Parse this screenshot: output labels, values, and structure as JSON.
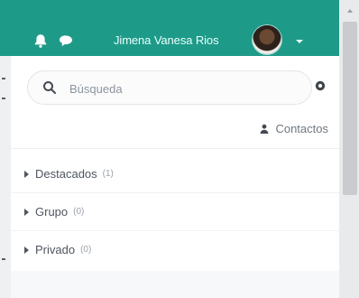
{
  "header": {
    "user_name": "Jimena Vanesa Rios",
    "bell_icon": "bell-icon",
    "chat_icon": "chat-bubble-icon",
    "avatar_icon": "user-avatar",
    "dropdown_icon": "caret-down-icon",
    "bg_color": "#1e9a89"
  },
  "search": {
    "placeholder": "Búsqueda",
    "value": "",
    "icon": "search-icon"
  },
  "settings": {
    "icon": "gear-icon"
  },
  "contacts": {
    "label": "Contactos",
    "icon": "user-icon"
  },
  "groups": [
    {
      "label": "Destacados",
      "count": "(1)"
    },
    {
      "label": "Grupo",
      "count": "(0)"
    },
    {
      "label": "Privado",
      "count": "(0)"
    }
  ]
}
